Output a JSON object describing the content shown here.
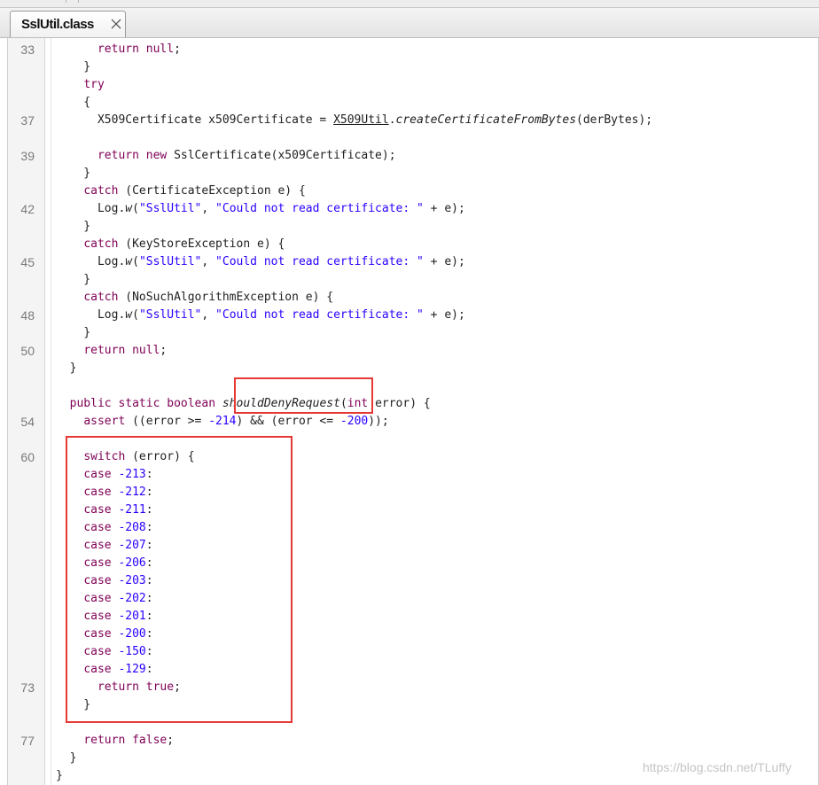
{
  "tab": {
    "title": "SslUtil.class",
    "close_icon": "close-icon"
  },
  "lines": [
    {
      "n": "33",
      "parts": [
        {
          "t": "      "
        },
        {
          "t": "return",
          "c": "kw"
        },
        {
          "t": " "
        },
        {
          "t": "null",
          "c": "kw"
        },
        {
          "t": ";"
        }
      ]
    },
    {
      "n": "",
      "parts": [
        {
          "t": "    }"
        }
      ]
    },
    {
      "n": "",
      "parts": [
        {
          "t": "    "
        },
        {
          "t": "try",
          "c": "kw"
        }
      ]
    },
    {
      "n": "",
      "parts": [
        {
          "t": "    {"
        }
      ]
    },
    {
      "n": "37",
      "parts": [
        {
          "t": "      X509Certificate x509Certificate = "
        },
        {
          "t": "X509Util",
          "c": "ul"
        },
        {
          "t": "."
        },
        {
          "t": "createCertificateFromBytes",
          "c": "it"
        },
        {
          "t": "(derBytes);"
        }
      ]
    },
    {
      "n": "",
      "parts": []
    },
    {
      "n": "39",
      "parts": [
        {
          "t": "      "
        },
        {
          "t": "return",
          "c": "kw"
        },
        {
          "t": " "
        },
        {
          "t": "new",
          "c": "kw"
        },
        {
          "t": " SslCertificate(x509Certificate);"
        }
      ]
    },
    {
      "n": "",
      "parts": [
        {
          "t": "    }"
        }
      ]
    },
    {
      "n": "",
      "parts": [
        {
          "t": "    "
        },
        {
          "t": "catch",
          "c": "kw"
        },
        {
          "t": " (CertificateException e) {"
        }
      ]
    },
    {
      "n": "42",
      "parts": [
        {
          "t": "      Log."
        },
        {
          "t": "w",
          "c": "it"
        },
        {
          "t": "("
        },
        {
          "t": "\"SslUtil\"",
          "c": "str"
        },
        {
          "t": ", "
        },
        {
          "t": "\"Could not read certificate: \"",
          "c": "str"
        },
        {
          "t": " + e);"
        }
      ]
    },
    {
      "n": "",
      "parts": [
        {
          "t": "    }"
        }
      ]
    },
    {
      "n": "",
      "parts": [
        {
          "t": "    "
        },
        {
          "t": "catch",
          "c": "kw"
        },
        {
          "t": " (KeyStoreException e) {"
        }
      ]
    },
    {
      "n": "45",
      "parts": [
        {
          "t": "      Log."
        },
        {
          "t": "w",
          "c": "it"
        },
        {
          "t": "("
        },
        {
          "t": "\"SslUtil\"",
          "c": "str"
        },
        {
          "t": ", "
        },
        {
          "t": "\"Could not read certificate: \"",
          "c": "str"
        },
        {
          "t": " + e);"
        }
      ]
    },
    {
      "n": "",
      "parts": [
        {
          "t": "    }"
        }
      ]
    },
    {
      "n": "",
      "parts": [
        {
          "t": "    "
        },
        {
          "t": "catch",
          "c": "kw"
        },
        {
          "t": " (NoSuchAlgorithmException e) {"
        }
      ]
    },
    {
      "n": "48",
      "parts": [
        {
          "t": "      Log."
        },
        {
          "t": "w",
          "c": "it"
        },
        {
          "t": "("
        },
        {
          "t": "\"SslUtil\"",
          "c": "str"
        },
        {
          "t": ", "
        },
        {
          "t": "\"Could not read certificate: \"",
          "c": "str"
        },
        {
          "t": " + e);"
        }
      ]
    },
    {
      "n": "",
      "parts": [
        {
          "t": "    }"
        }
      ]
    },
    {
      "n": "50",
      "parts": [
        {
          "t": "    "
        },
        {
          "t": "return",
          "c": "kw"
        },
        {
          "t": " "
        },
        {
          "t": "null",
          "c": "kw"
        },
        {
          "t": ";"
        }
      ]
    },
    {
      "n": "",
      "parts": [
        {
          "t": "  }"
        }
      ]
    },
    {
      "n": "",
      "parts": []
    },
    {
      "n": "",
      "parts": [
        {
          "t": "  "
        },
        {
          "t": "public",
          "c": "kw"
        },
        {
          "t": " "
        },
        {
          "t": "static",
          "c": "kw"
        },
        {
          "t": " "
        },
        {
          "t": "boolean",
          "c": "kw"
        },
        {
          "t": " "
        },
        {
          "t": "shouldDenyRequest",
          "c": "it"
        },
        {
          "t": "("
        },
        {
          "t": "int",
          "c": "kw"
        },
        {
          "t": " error) {"
        }
      ]
    },
    {
      "n": "54",
      "parts": [
        {
          "t": "    "
        },
        {
          "t": "assert",
          "c": "kw"
        },
        {
          "t": " ((error >= "
        },
        {
          "t": "-214",
          "c": "num"
        },
        {
          "t": ") && (error <= "
        },
        {
          "t": "-200",
          "c": "num"
        },
        {
          "t": "));"
        }
      ]
    },
    {
      "n": "",
      "parts": []
    },
    {
      "n": "60",
      "parts": [
        {
          "t": "    "
        },
        {
          "t": "switch",
          "c": "kw"
        },
        {
          "t": " (error) {"
        }
      ]
    },
    {
      "n": "",
      "parts": [
        {
          "t": "    "
        },
        {
          "t": "case",
          "c": "kw"
        },
        {
          "t": " "
        },
        {
          "t": "-213",
          "c": "num"
        },
        {
          "t": ":"
        }
      ]
    },
    {
      "n": "",
      "parts": [
        {
          "t": "    "
        },
        {
          "t": "case",
          "c": "kw"
        },
        {
          "t": " "
        },
        {
          "t": "-212",
          "c": "num"
        },
        {
          "t": ":"
        }
      ]
    },
    {
      "n": "",
      "parts": [
        {
          "t": "    "
        },
        {
          "t": "case",
          "c": "kw"
        },
        {
          "t": " "
        },
        {
          "t": "-211",
          "c": "num"
        },
        {
          "t": ":"
        }
      ]
    },
    {
      "n": "",
      "parts": [
        {
          "t": "    "
        },
        {
          "t": "case",
          "c": "kw"
        },
        {
          "t": " "
        },
        {
          "t": "-208",
          "c": "num"
        },
        {
          "t": ":"
        }
      ]
    },
    {
      "n": "",
      "parts": [
        {
          "t": "    "
        },
        {
          "t": "case",
          "c": "kw"
        },
        {
          "t": " "
        },
        {
          "t": "-207",
          "c": "num"
        },
        {
          "t": ":"
        }
      ]
    },
    {
      "n": "",
      "parts": [
        {
          "t": "    "
        },
        {
          "t": "case",
          "c": "kw"
        },
        {
          "t": " "
        },
        {
          "t": "-206",
          "c": "num"
        },
        {
          "t": ":"
        }
      ]
    },
    {
      "n": "",
      "parts": [
        {
          "t": "    "
        },
        {
          "t": "case",
          "c": "kw"
        },
        {
          "t": " "
        },
        {
          "t": "-203",
          "c": "num"
        },
        {
          "t": ":"
        }
      ]
    },
    {
      "n": "",
      "parts": [
        {
          "t": "    "
        },
        {
          "t": "case",
          "c": "kw"
        },
        {
          "t": " "
        },
        {
          "t": "-202",
          "c": "num"
        },
        {
          "t": ":"
        }
      ]
    },
    {
      "n": "",
      "parts": [
        {
          "t": "    "
        },
        {
          "t": "case",
          "c": "kw"
        },
        {
          "t": " "
        },
        {
          "t": "-201",
          "c": "num"
        },
        {
          "t": ":"
        }
      ]
    },
    {
      "n": "",
      "parts": [
        {
          "t": "    "
        },
        {
          "t": "case",
          "c": "kw"
        },
        {
          "t": " "
        },
        {
          "t": "-200",
          "c": "num"
        },
        {
          "t": ":"
        }
      ]
    },
    {
      "n": "",
      "parts": [
        {
          "t": "    "
        },
        {
          "t": "case",
          "c": "kw"
        },
        {
          "t": " "
        },
        {
          "t": "-150",
          "c": "num"
        },
        {
          "t": ":"
        }
      ]
    },
    {
      "n": "",
      "parts": [
        {
          "t": "    "
        },
        {
          "t": "case",
          "c": "kw"
        },
        {
          "t": " "
        },
        {
          "t": "-129",
          "c": "num"
        },
        {
          "t": ":"
        }
      ]
    },
    {
      "n": "73",
      "parts": [
        {
          "t": "      "
        },
        {
          "t": "return",
          "c": "kw"
        },
        {
          "t": " "
        },
        {
          "t": "true",
          "c": "kw"
        },
        {
          "t": ";"
        }
      ]
    },
    {
      "n": "",
      "parts": [
        {
          "t": "    }"
        }
      ]
    },
    {
      "n": "",
      "parts": []
    },
    {
      "n": "77",
      "parts": [
        {
          "t": "    "
        },
        {
          "t": "return",
          "c": "kw"
        },
        {
          "t": " "
        },
        {
          "t": "false",
          "c": "kw"
        },
        {
          "t": ";"
        }
      ]
    },
    {
      "n": "",
      "parts": [
        {
          "t": "  }"
        }
      ]
    },
    {
      "n": "",
      "parts": [
        {
          "t": "}"
        }
      ]
    }
  ],
  "highlights": [
    {
      "name": "method-name-highlight",
      "label": "shouldDenyRequest"
    },
    {
      "name": "switch-block-highlight",
      "label": "switch"
    }
  ],
  "watermark": "https://blog.csdn.net/TLuffy",
  "colors": {
    "keyword": "#7f0055",
    "string": "#2a00ff",
    "highlight": "#e53935"
  }
}
